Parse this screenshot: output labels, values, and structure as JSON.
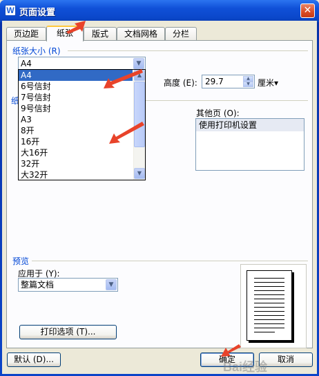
{
  "window": {
    "title": "页面设置",
    "icon": "W",
    "close": "✕"
  },
  "tabs": [
    "页边距",
    "纸张",
    "版式",
    "文档网格",
    "分栏"
  ],
  "active_tab": "纸张",
  "paper_size": {
    "group_label": "纸张大小 (R)",
    "selected": "A4",
    "options": [
      "A4",
      "6号信封",
      "7号信封",
      "9号信封",
      "A3",
      "8开",
      "16开",
      "大16开",
      "32开",
      "大32开"
    ],
    "height_label": "高度 (E):",
    "height_value": "29.7",
    "unit": "厘米"
  },
  "paper_source": {
    "group_label_fragment": "纸",
    "other_pages_label": "其他页 (O):",
    "other_pages_items": [
      "使用打印机设置"
    ]
  },
  "preview": {
    "group_label": "预览",
    "apply_to_label": "应用于 (Y):",
    "apply_to_value": "整篇文档"
  },
  "buttons": {
    "print_options": "打印选项 (T)...",
    "default": "默认 (D)...",
    "ok": "确定",
    "cancel": "取消"
  },
  "watermark": "Bai经验",
  "colors": {
    "titlebar": "#0a4fd0",
    "accent": "#316ac5",
    "arrow": "#e8432a"
  }
}
